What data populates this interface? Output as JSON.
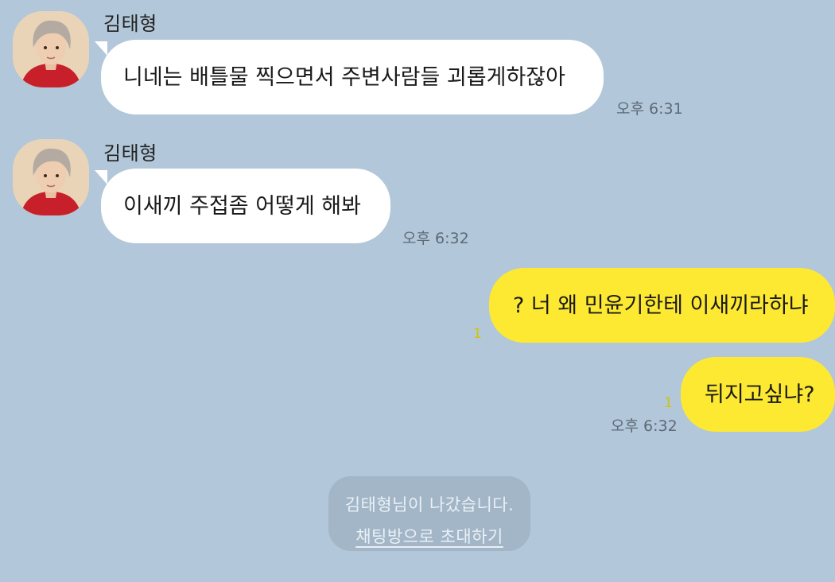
{
  "colors": {
    "chat_background": "#b2c7d9",
    "incoming_bubble": "#ffffff",
    "outgoing_bubble": "#fee932",
    "timestamp_text": "#5d6a77",
    "unread_indicator": "#d8c200",
    "notice_background": "#a3b6c8"
  },
  "messages": [
    {
      "direction": "incoming",
      "sender": "김태형",
      "avatar": "profile-photo",
      "text": "니네는 배틀물 찍으면서 주변사람들 괴롭게하잖아",
      "time": "오후 6:31"
    },
    {
      "direction": "incoming",
      "sender": "김태형",
      "avatar": "profile-photo",
      "text": "이새끼 주접좀 어떻게 해봐",
      "time": "오후 6:32"
    },
    {
      "direction": "outgoing",
      "text": "? 너 왜 민윤기한테 이새끼라하냐",
      "unread": "1"
    },
    {
      "direction": "outgoing",
      "text": "뒤지고싶냐?",
      "unread": "1",
      "time": "오후 6:32"
    }
  ],
  "notice": {
    "left_text": "김태형님이 나갔습니다.",
    "invite_link": "채팅방으로 초대하기"
  }
}
